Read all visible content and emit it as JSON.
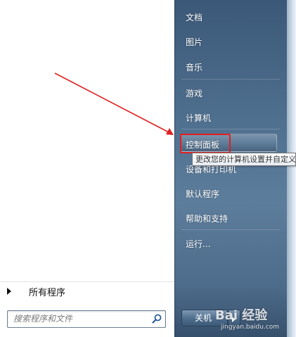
{
  "start_menu": {
    "right_items": {
      "documents": "文档",
      "pictures": "图片",
      "music": "音乐",
      "games": "游戏",
      "computer": "计算机",
      "control_panel": "控制面板",
      "devices_printers": "设备和打印机",
      "default_programs": "默认程序",
      "help_support": "帮助和支持",
      "run": "运行..."
    },
    "tooltip": "更改您的计算机设置并自定义其功能。",
    "all_programs": "所有程序",
    "search": {
      "placeholder": "搜索程序和文件"
    },
    "shutdown_label": "关机"
  },
  "watermark": {
    "brand": "Bai 经验",
    "url": "jingyan.baidu.com"
  },
  "colors": {
    "annotation_red": "#e02020",
    "pane_blue": "#4f6f8f"
  }
}
